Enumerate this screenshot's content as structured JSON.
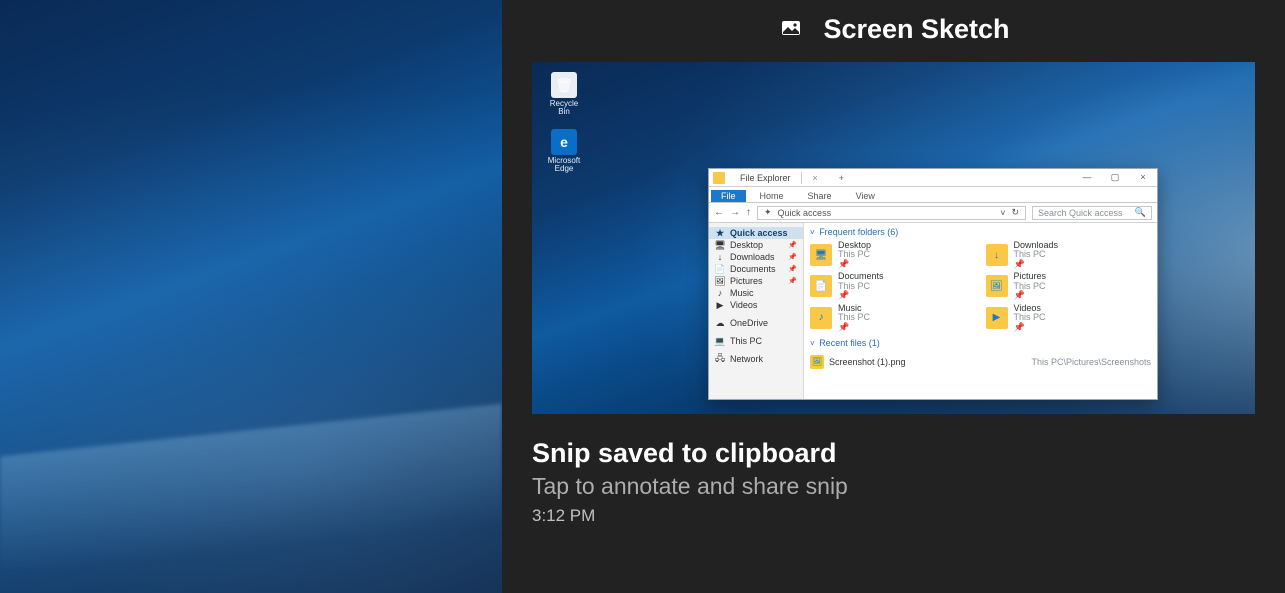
{
  "notification": {
    "app_name": "Screen Sketch",
    "title": "Snip saved to clipboard",
    "subtitle": "Tap to annotate and share snip",
    "time": "3:12 PM"
  },
  "thumb": {
    "desktop_icons": [
      {
        "label": "Recycle Bin",
        "glyph": "🗑"
      },
      {
        "label": "Microsoft Edge",
        "glyph": "e"
      }
    ],
    "explorer": {
      "window_title": "File Explorer",
      "close_glyph": "×",
      "plus_glyph": "+",
      "win_min": "—",
      "win_max": "▢",
      "win_close": "×",
      "ribbon_tabs": [
        "File",
        "Home",
        "Share",
        "View"
      ],
      "address": {
        "back": "←",
        "fwd": "→",
        "up": "↑",
        "sep": "›",
        "bc_glyph": "✦",
        "bc_text": "Quick access",
        "refresh": "↻",
        "search_placeholder": "Search Quick access",
        "search_glyph": "🔍"
      },
      "sidebar": {
        "items": [
          {
            "label": "Quick access",
            "glyph": "★",
            "selected": true,
            "pin": ""
          },
          {
            "label": "Desktop",
            "glyph": "🖥",
            "pin": "📌"
          },
          {
            "label": "Downloads",
            "glyph": "↓",
            "pin": "📌"
          },
          {
            "label": "Documents",
            "glyph": "📄",
            "pin": "📌"
          },
          {
            "label": "Pictures",
            "glyph": "🖼",
            "pin": "📌"
          },
          {
            "label": "Music",
            "glyph": "♪",
            "pin": ""
          },
          {
            "label": "Videos",
            "glyph": "▶",
            "pin": ""
          },
          {
            "label": "OneDrive",
            "glyph": "☁",
            "pin": "",
            "gap": true
          },
          {
            "label": "This PC",
            "glyph": "💻",
            "pin": "",
            "gap": true
          },
          {
            "label": "Network",
            "glyph": "🖧",
            "pin": "",
            "gap": true
          }
        ]
      },
      "group_frequent": {
        "label": "Frequent folders (6)",
        "chev": "˅",
        "items": [
          {
            "name": "Desktop",
            "sub": "This PC",
            "glyph": "🖥"
          },
          {
            "name": "Downloads",
            "sub": "This PC",
            "glyph": "↓"
          },
          {
            "name": "Documents",
            "sub": "This PC",
            "glyph": "📄"
          },
          {
            "name": "Pictures",
            "sub": "This PC",
            "glyph": "🖼"
          },
          {
            "name": "Music",
            "sub": "This PC",
            "glyph": "♪"
          },
          {
            "name": "Videos",
            "sub": "This PC",
            "glyph": "▶"
          }
        ]
      },
      "group_recent": {
        "label": "Recent files (1)",
        "chev": "˅",
        "file_name": "Screenshot (1).png",
        "file_loc": "This PC\\Pictures\\Screenshots"
      }
    }
  }
}
